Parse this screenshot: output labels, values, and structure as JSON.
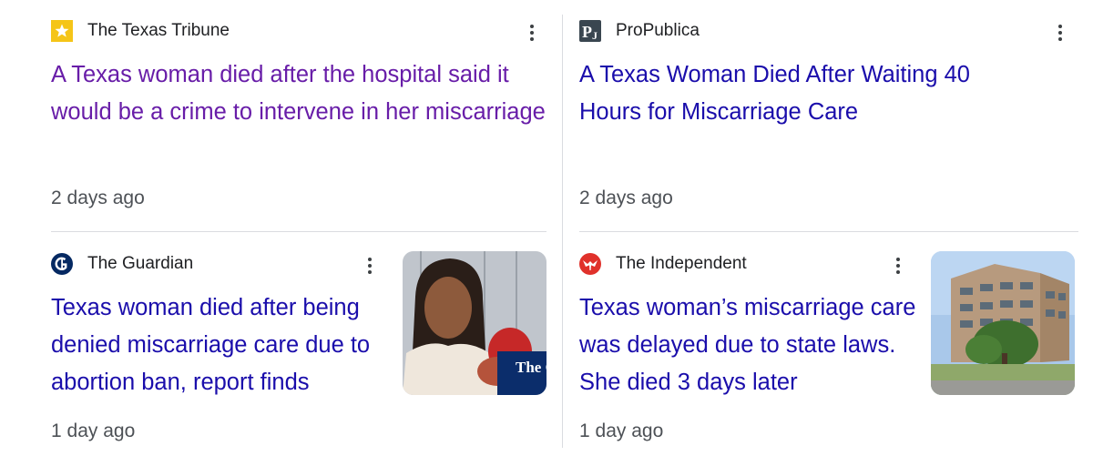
{
  "results": [
    {
      "source": "The Texas Tribune",
      "logo_icon": "texas-tribune-star-icon",
      "headline": "A Texas woman died after the hospital said it would be a crime to intervene in her miscarriage",
      "time": "2 days ago",
      "visited": true
    },
    {
      "source": "ProPublica",
      "logo_icon": "propublica-logo-icon",
      "headline": "A Texas Woman Died After Waiting 40 Hours for Miscarriage Care",
      "time": "2 days ago",
      "visited": false
    },
    {
      "source": "The Guardian",
      "logo_icon": "guardian-g-icon",
      "headline": "Texas woman died after being denied miscarriage care due to abortion ban, report finds",
      "time": "1 day ago",
      "visited": false,
      "thumbnail_watermark": "The Guar"
    },
    {
      "source": "The Independent",
      "logo_icon": "independent-eagle-icon",
      "headline": "Texas woman’s miscarriage care was delayed due to state laws. She died 3 days later",
      "time": "1 day ago",
      "visited": false
    }
  ],
  "colors": {
    "visited_link": "#681da8",
    "link": "#1a0dab",
    "meta_text": "#4d5156",
    "divider": "#dadce0"
  }
}
